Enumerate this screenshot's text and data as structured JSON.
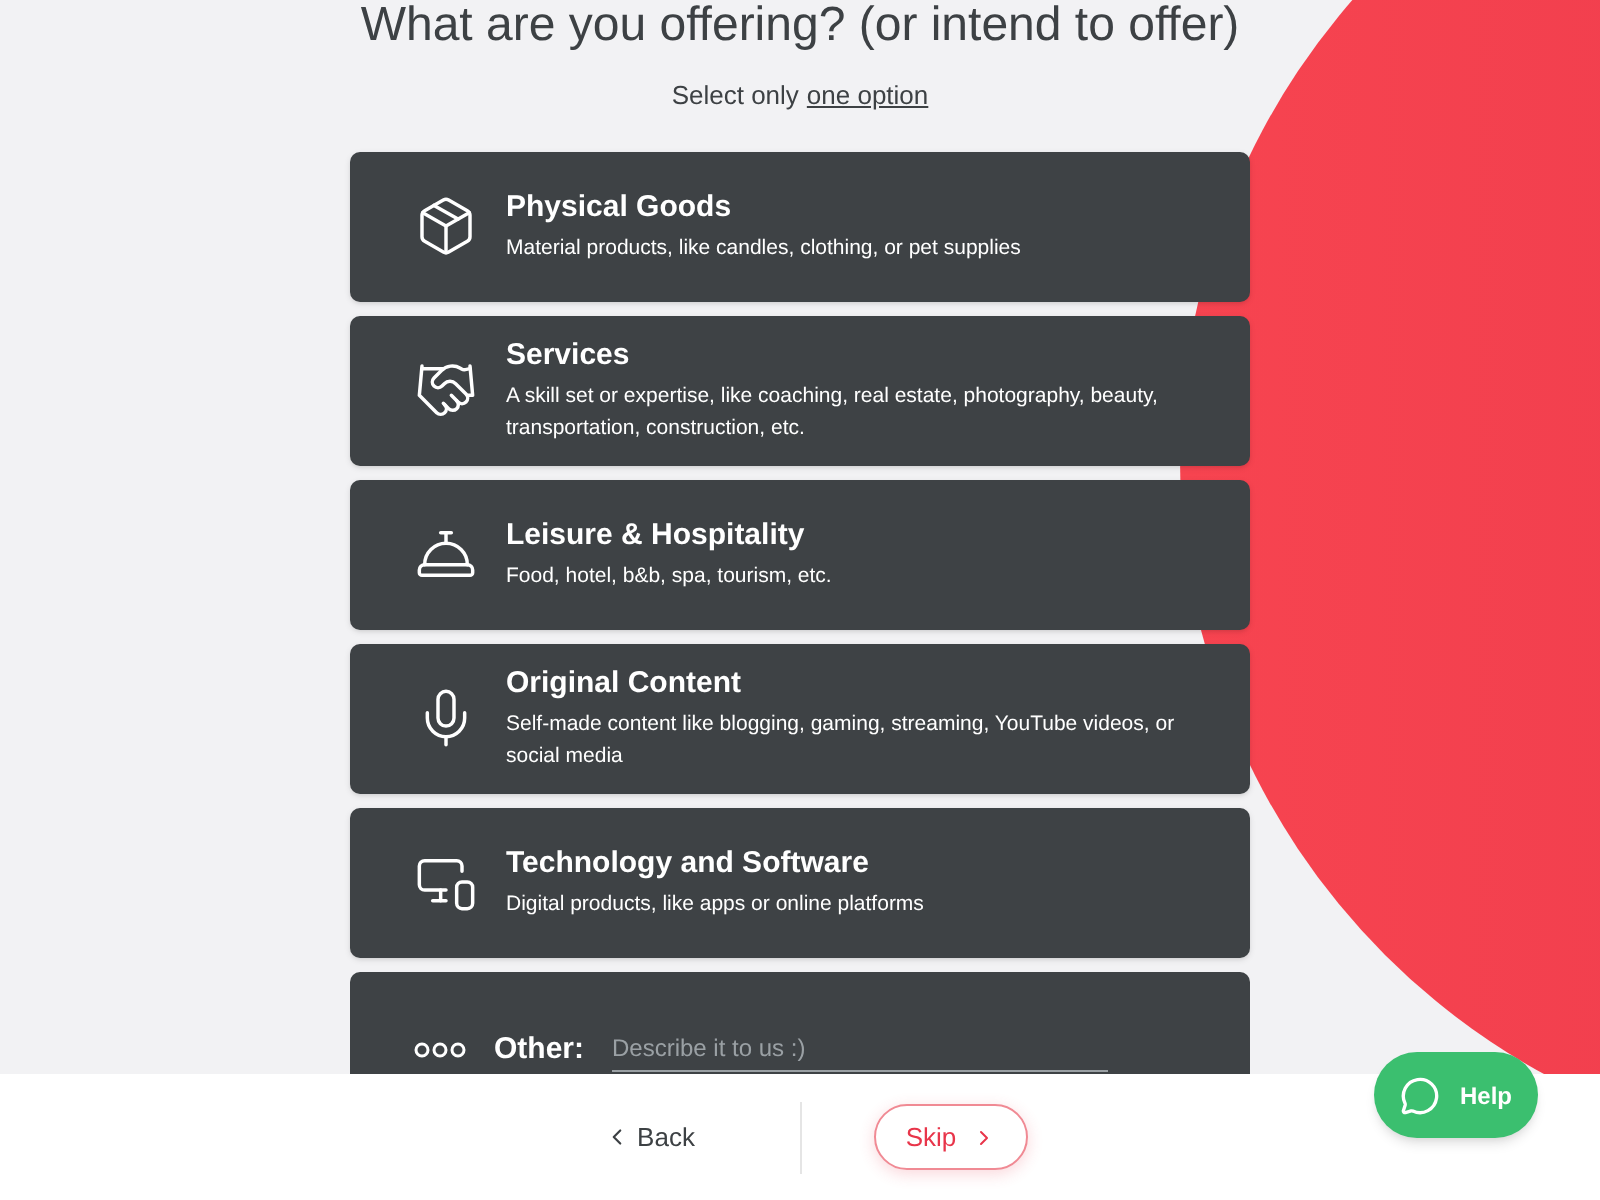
{
  "heading": "What are you offering? (or intend to offer)",
  "instruction": {
    "text": "Select only",
    "link": "one option"
  },
  "options": [
    {
      "kind": "goods",
      "title": "Physical Goods",
      "description": "Material products, like candles, clothing, or pet supplies"
    },
    {
      "kind": "services",
      "title": "Services",
      "description": "A skill set or expertise, like coaching, real estate, photography, beauty, transportation, construction, etc."
    },
    {
      "kind": "leisure",
      "title": "Leisure & Hospitality",
      "description": "Food, hotel, b&b, spa, tourism, etc."
    },
    {
      "kind": "content",
      "title": "Original Content",
      "description": "Self-made content like blogging, gaming, streaming, YouTube videos, or social media"
    },
    {
      "kind": "tech",
      "title": "Technology and Software",
      "description": "Digital products, like apps or online platforms"
    }
  ],
  "other": {
    "label": "Other:",
    "placeholder": "Describe it to us :)"
  },
  "footer": {
    "back": "Back",
    "skip": "Skip"
  },
  "help": "Help"
}
